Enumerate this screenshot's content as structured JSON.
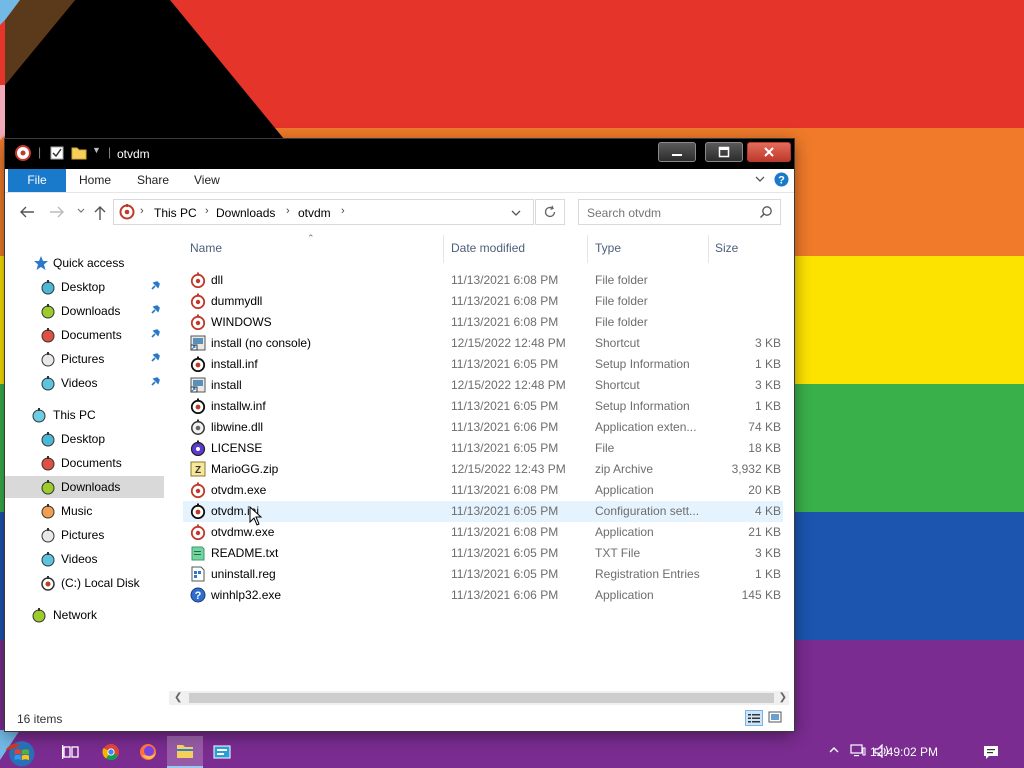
{
  "window": {
    "title": "otvdm",
    "minimize_icon": "minimize-icon",
    "maximize_icon": "maximize-icon",
    "close_icon": "close-icon"
  },
  "ribbon": {
    "tabs": [
      "File",
      "Home",
      "Share",
      "View"
    ]
  },
  "address": {
    "crumbs": [
      "This PC",
      "Downloads",
      "otvdm"
    ]
  },
  "search": {
    "placeholder": "Search otvdm"
  },
  "nav": {
    "quick_access": "Quick access",
    "quick_items": [
      "Desktop",
      "Downloads",
      "Documents",
      "Pictures",
      "Videos"
    ],
    "this_pc": "This PC",
    "pc_items": [
      "Desktop",
      "Documents",
      "Downloads",
      "Music",
      "Pictures",
      "Videos",
      "(C:) Local Disk"
    ],
    "network": "Network",
    "selected": "Downloads"
  },
  "columns": {
    "name": "Name",
    "date": "Date modified",
    "type": "Type",
    "size": "Size"
  },
  "files": [
    {
      "name": "dll",
      "date": "11/13/2021 6:08 PM",
      "type": "File folder",
      "size": "",
      "icon": "folder-icon"
    },
    {
      "name": "dummydll",
      "date": "11/13/2021 6:08 PM",
      "type": "File folder",
      "size": "",
      "icon": "folder-icon"
    },
    {
      "name": "WINDOWS",
      "date": "11/13/2021 6:08 PM",
      "type": "File folder",
      "size": "",
      "icon": "folder-icon"
    },
    {
      "name": "install (no console)",
      "date": "12/15/2022 12:48 PM",
      "type": "Shortcut",
      "size": "3 KB",
      "icon": "shortcut-icon"
    },
    {
      "name": "install.inf",
      "date": "11/13/2021 6:05 PM",
      "type": "Setup Information",
      "size": "1 KB",
      "icon": "inf-icon"
    },
    {
      "name": "install",
      "date": "12/15/2022 12:48 PM",
      "type": "Shortcut",
      "size": "3 KB",
      "icon": "shortcut-icon"
    },
    {
      "name": "installw.inf",
      "date": "11/13/2021 6:05 PM",
      "type": "Setup Information",
      "size": "1 KB",
      "icon": "inf-icon"
    },
    {
      "name": "libwine.dll",
      "date": "11/13/2021 6:06 PM",
      "type": "Application exten...",
      "size": "74 KB",
      "icon": "dll-icon"
    },
    {
      "name": "LICENSE",
      "date": "11/13/2021 6:05 PM",
      "type": "File",
      "size": "18 KB",
      "icon": "file-icon"
    },
    {
      "name": "MarioGG.zip",
      "date": "12/15/2022 12:43 PM",
      "type": "zip Archive",
      "size": "3,932 KB",
      "icon": "zip-icon"
    },
    {
      "name": "otvdm.exe",
      "date": "11/13/2021 6:08 PM",
      "type": "Application",
      "size": "20 KB",
      "icon": "exe-icon"
    },
    {
      "name": "otvdm.ini",
      "date": "11/13/2021 6:05 PM",
      "type": "Configuration sett...",
      "size": "4 KB",
      "icon": "ini-icon"
    },
    {
      "name": "otvdmw.exe",
      "date": "11/13/2021 6:08 PM",
      "type": "Application",
      "size": "21 KB",
      "icon": "exe-icon"
    },
    {
      "name": "README.txt",
      "date": "11/13/2021 6:05 PM",
      "type": "TXT File",
      "size": "3 KB",
      "icon": "txt-icon"
    },
    {
      "name": "uninstall.reg",
      "date": "11/13/2021 6:05 PM",
      "type": "Registration Entries",
      "size": "1 KB",
      "icon": "reg-icon"
    },
    {
      "name": "winhlp32.exe",
      "date": "11/13/2021 6:06 PM",
      "type": "Application",
      "size": "145 KB",
      "icon": "help-icon"
    }
  ],
  "hovered_file": "otvdm.ini",
  "status": {
    "item_count": "16 items"
  },
  "taskbar": {
    "clock": "12:49:02 PM",
    "apps": [
      "start-icon",
      "task-view-icon",
      "chrome-icon",
      "firefox-icon",
      "file-explorer-icon",
      "winhlp-icon"
    ],
    "active_app": "file-explorer-icon"
  },
  "colors": {
    "accent": "#1979ca",
    "selection": "#d9d9d9",
    "hover": "#e5f3ff",
    "close": "#c0392b",
    "stripe_red": "#e5342a",
    "stripe_orange": "#f07a2a",
    "stripe_yellow": "#fde300",
    "stripe_green": "#3ab04a",
    "stripe_blue": "#1b55b0",
    "stripe_purple": "#7a2c90"
  }
}
